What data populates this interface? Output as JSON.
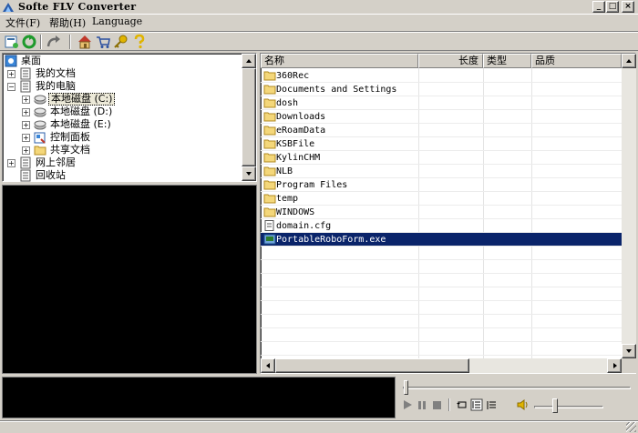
{
  "window": {
    "title": "Softe FLV Converter",
    "controls": {
      "minimize": "_",
      "maximize": "□",
      "close": "×"
    }
  },
  "menu": {
    "file": "文件(F)",
    "help": "帮助(H)",
    "language": "Language"
  },
  "toolbar": {
    "icons": [
      "open-icon",
      "refresh-icon",
      "redo-icon",
      "home-icon",
      "cart-icon",
      "key-icon",
      "help-icon"
    ]
  },
  "tree": {
    "items": [
      {
        "label": "桌面",
        "icon": "desktop-icon"
      },
      {
        "label": "我的文档",
        "icon": "documents-icon",
        "expander": "+"
      },
      {
        "label": "我的电脑",
        "icon": "computer-icon",
        "expander": "−"
      },
      {
        "label": "本地磁盘 (C:)",
        "icon": "drive-icon",
        "expander": "+",
        "selected": true
      },
      {
        "label": "本地磁盘 (D:)",
        "icon": "drive-icon",
        "expander": "+"
      },
      {
        "label": "本地磁盘 (E:)",
        "icon": "drive-icon",
        "expander": "+"
      },
      {
        "label": "控制面板",
        "icon": "control-panel-icon",
        "expander": "+"
      },
      {
        "label": "共享文档",
        "icon": "folder-icon",
        "expander": "+"
      },
      {
        "label": "网上邻居",
        "icon": "network-icon",
        "expander": "+"
      },
      {
        "label": "回收站",
        "icon": "recycle-bin-icon"
      }
    ]
  },
  "filelist": {
    "columns": [
      "名称",
      "长度",
      "类型",
      "品质"
    ],
    "rows": [
      {
        "name": "360Rec",
        "icon": "folder-icon"
      },
      {
        "name": "Documents and Settings",
        "icon": "folder-icon"
      },
      {
        "name": "dosh",
        "icon": "folder-icon"
      },
      {
        "name": "Downloads",
        "icon": "folder-icon"
      },
      {
        "name": "eRoamData",
        "icon": "folder-icon"
      },
      {
        "name": "KSBFile",
        "icon": "folder-icon"
      },
      {
        "name": "KylinCHM",
        "icon": "folder-icon"
      },
      {
        "name": "NLB",
        "icon": "folder-icon"
      },
      {
        "name": "Program Files",
        "icon": "folder-icon"
      },
      {
        "name": "temp",
        "icon": "folder-icon"
      },
      {
        "name": "WINDOWS",
        "icon": "folder-icon"
      },
      {
        "name": "domain.cfg",
        "icon": "file-icon"
      },
      {
        "name": "PortableRoboForm.exe",
        "icon": "exe-icon",
        "selected": true
      }
    ]
  },
  "player": {
    "controls": [
      "play-icon",
      "pause-icon",
      "stop-icon",
      "loop-icon",
      "playlist-icon",
      "list-icon",
      "volume-icon"
    ]
  },
  "colors": {
    "face": "#d4d0c8",
    "selection": "#0a246a",
    "folder": "#f4d77a"
  }
}
